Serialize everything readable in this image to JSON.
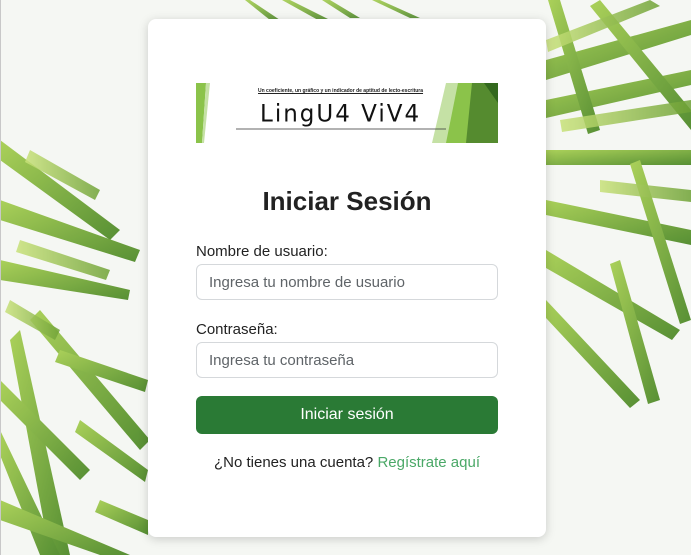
{
  "banner": {
    "tagline": "Un coeficiente, un gráfico y un indicador de aptitud de lecto-escritura",
    "logo": "LingU4 ViV4"
  },
  "login": {
    "title": "Iniciar Sesión",
    "username_label": "Nombre de usuario:",
    "username_placeholder": "Ingresa tu nombre de usuario",
    "password_label": "Contraseña:",
    "password_placeholder": "Ingresa tu contraseña",
    "submit_label": "Iniciar sesión",
    "signup_prompt": "¿No tienes una cuenta?",
    "signup_link": "Regístrate aquí"
  },
  "colors": {
    "button": "#2a7a35",
    "link": "#4aa867",
    "leaf": "#7cb342"
  }
}
